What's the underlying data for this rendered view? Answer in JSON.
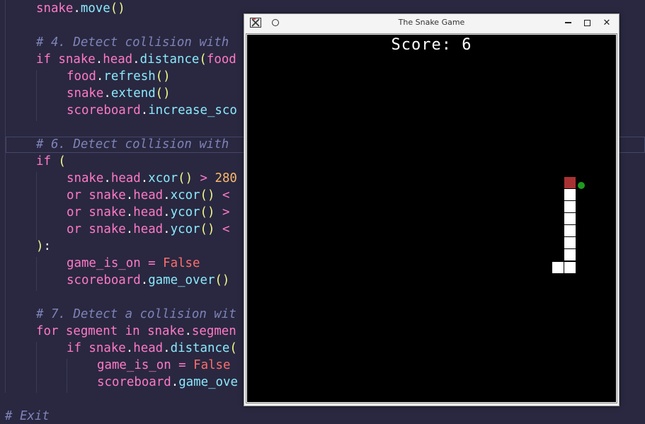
{
  "editor": {
    "lines": [
      {
        "indent": 0,
        "parts": [
          [
            "var",
            "snake"
          ],
          [
            "plain",
            "."
          ],
          [
            "fn",
            "move"
          ],
          [
            "paren",
            "()"
          ]
        ]
      },
      {
        "indent": 0,
        "parts": []
      },
      {
        "indent": 0,
        "parts": [
          [
            "cmt",
            "# 4. Detect collision with"
          ]
        ]
      },
      {
        "indent": 0,
        "parts": [
          [
            "kw",
            "if "
          ],
          [
            "var",
            "snake"
          ],
          [
            "plain",
            "."
          ],
          [
            "var",
            "head"
          ],
          [
            "plain",
            "."
          ],
          [
            "fn",
            "distance"
          ],
          [
            "paren",
            "("
          ],
          [
            "var",
            "food"
          ]
        ]
      },
      {
        "indent": 1,
        "parts": [
          [
            "var",
            "food"
          ],
          [
            "plain",
            "."
          ],
          [
            "fn",
            "refresh"
          ],
          [
            "paren",
            "()"
          ]
        ]
      },
      {
        "indent": 1,
        "parts": [
          [
            "var",
            "snake"
          ],
          [
            "plain",
            "."
          ],
          [
            "fn",
            "extend"
          ],
          [
            "paren",
            "()"
          ]
        ]
      },
      {
        "indent": 1,
        "parts": [
          [
            "var",
            "scoreboard"
          ],
          [
            "plain",
            "."
          ],
          [
            "fn",
            "increase_sco"
          ]
        ]
      },
      {
        "indent": 0,
        "parts": []
      },
      {
        "indent": 0,
        "parts": [
          [
            "cmt",
            "# 6. Detect collision with"
          ]
        ]
      },
      {
        "indent": 0,
        "parts": [
          [
            "kw",
            "if "
          ],
          [
            "paren",
            "("
          ]
        ]
      },
      {
        "indent": 1,
        "parts": [
          [
            "var",
            "snake"
          ],
          [
            "plain",
            "."
          ],
          [
            "var",
            "head"
          ],
          [
            "plain",
            "."
          ],
          [
            "fn",
            "xcor"
          ],
          [
            "paren",
            "()"
          ],
          [
            "op",
            " > "
          ],
          [
            "num",
            "280"
          ]
        ]
      },
      {
        "indent": 1,
        "parts": [
          [
            "kw",
            "or "
          ],
          [
            "var",
            "snake"
          ],
          [
            "plain",
            "."
          ],
          [
            "var",
            "head"
          ],
          [
            "plain",
            "."
          ],
          [
            "fn",
            "xcor"
          ],
          [
            "paren",
            "()"
          ],
          [
            "op",
            " <"
          ]
        ]
      },
      {
        "indent": 1,
        "parts": [
          [
            "kw",
            "or "
          ],
          [
            "var",
            "snake"
          ],
          [
            "plain",
            "."
          ],
          [
            "var",
            "head"
          ],
          [
            "plain",
            "."
          ],
          [
            "fn",
            "ycor"
          ],
          [
            "paren",
            "()"
          ],
          [
            "op",
            " >"
          ]
        ]
      },
      {
        "indent": 1,
        "parts": [
          [
            "kw",
            "or "
          ],
          [
            "var",
            "snake"
          ],
          [
            "plain",
            "."
          ],
          [
            "var",
            "head"
          ],
          [
            "plain",
            "."
          ],
          [
            "fn",
            "ycor"
          ],
          [
            "paren",
            "()"
          ],
          [
            "op",
            " <"
          ]
        ]
      },
      {
        "indent": 0,
        "parts": [
          [
            "paren",
            ")"
          ],
          [
            "plain",
            ":"
          ]
        ]
      },
      {
        "indent": 1,
        "parts": [
          [
            "var",
            "game_is_on"
          ],
          [
            "op",
            " = "
          ],
          [
            "bool",
            "False"
          ]
        ]
      },
      {
        "indent": 1,
        "parts": [
          [
            "var",
            "scoreboard"
          ],
          [
            "plain",
            "."
          ],
          [
            "fn",
            "game_over"
          ],
          [
            "paren",
            "()"
          ]
        ]
      },
      {
        "indent": 0,
        "parts": []
      },
      {
        "indent": 0,
        "parts": [
          [
            "cmt",
            "# 7. Detect a collision wit"
          ]
        ]
      },
      {
        "indent": 0,
        "parts": [
          [
            "kw",
            "for "
          ],
          [
            "var",
            "segment"
          ],
          [
            "kw",
            " in "
          ],
          [
            "var",
            "snake"
          ],
          [
            "plain",
            "."
          ],
          [
            "var",
            "segmen"
          ]
        ]
      },
      {
        "indent": 1,
        "parts": [
          [
            "kw",
            "if "
          ],
          [
            "var",
            "snake"
          ],
          [
            "plain",
            "."
          ],
          [
            "var",
            "head"
          ],
          [
            "plain",
            "."
          ],
          [
            "fn",
            "distance"
          ],
          [
            "paren",
            "("
          ]
        ]
      },
      {
        "indent": 2,
        "parts": [
          [
            "var",
            "game_is_on"
          ],
          [
            "op",
            " = "
          ],
          [
            "bool",
            "False"
          ]
        ]
      },
      {
        "indent": 2,
        "parts": [
          [
            "var",
            "scoreboard"
          ],
          [
            "plain",
            "."
          ],
          [
            "fn",
            "game_ove"
          ]
        ]
      },
      {
        "indent": 0,
        "parts": []
      },
      {
        "indent": -1,
        "parts": [
          [
            "cmt",
            "# Exit"
          ]
        ]
      }
    ]
  },
  "window": {
    "title": "The Snake Game",
    "app_icon": "turtle-tk-icon",
    "pin_icon": "circle-pin-icon",
    "minimize_icon": "minimize-icon",
    "maximize_icon": "maximize-icon",
    "close_icon": "close-icon",
    "close_glyph": "✕"
  },
  "game": {
    "score_text": "Score: 6",
    "score": 6,
    "colors": {
      "background": "#000000",
      "snake_body": "#ffffff",
      "snake_head": "#a83232",
      "food": "#1e9a1e"
    }
  }
}
